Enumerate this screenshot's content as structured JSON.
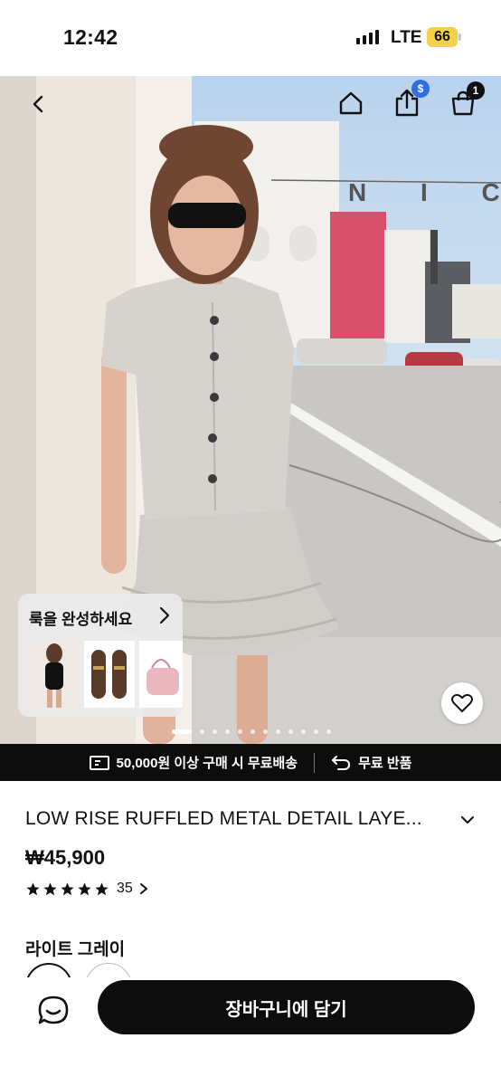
{
  "status_bar": {
    "time": "12:42",
    "network": "LTE",
    "battery": "66"
  },
  "header": {
    "share_badge": "$",
    "cart_count": "1",
    "icons": [
      "back-arrow-icon",
      "home-icon",
      "share-icon",
      "cart-icon"
    ]
  },
  "hero": {
    "street_sign_letters": "N I C",
    "look_card": {
      "title": "룩을 완성하세요",
      "thumbnails": [
        "swimsuit",
        "loafers",
        "pink-bag"
      ]
    },
    "carousel": {
      "total": 12,
      "active_index": 0
    }
  },
  "shipping_banner": {
    "free_shipping": "50,000원 이상 구매 시 무료배송",
    "free_returns": "무료 반품"
  },
  "product": {
    "title": "LOW RISE RUFFLED METAL DETAIL LAYE...",
    "price": "₩45,900",
    "rating": 5,
    "review_count": "35",
    "color_name": "라이트 그레이"
  },
  "actions": {
    "add_to_cart": "장바구니에 담기"
  },
  "colors": {
    "accent": "#0d0d0d",
    "badge_blue": "#2f6fe0",
    "battery": "#f3d24a"
  }
}
